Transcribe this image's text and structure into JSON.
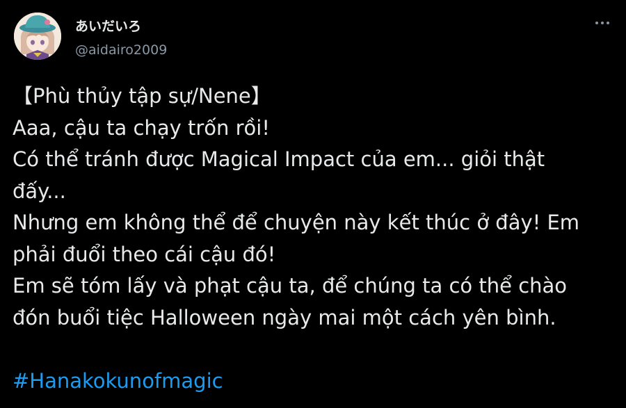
{
  "author": {
    "display_name": "あいだいろ",
    "username": "@aidairo2009"
  },
  "tweet": {
    "lines": [
      "【Phù thủy tập sự/Nene】",
      "Aaa, cậu ta chạy trốn rồi!",
      "Có thể tránh được Magical Impact của em... giỏi thật",
      "đấy...",
      "Nhưng em không thể để chuyện này kết thúc ở đây! Em",
      "phải đuổi theo cái cậu đó!",
      "Em sẽ tóm lấy và phạt cậu ta, để chúng ta có thể chào",
      "đón buổi tiệc Halloween ngày mai một cách yên bình."
    ],
    "hashtag": "#Hanakokunofmagic"
  },
  "icons": {
    "avatar": "anime-avatar",
    "more": "more-horizontal-icon"
  },
  "colors": {
    "background": "#000000",
    "text": "#e7e9ea",
    "secondary_text": "#8b98a5",
    "link": "#1d9bf0"
  }
}
